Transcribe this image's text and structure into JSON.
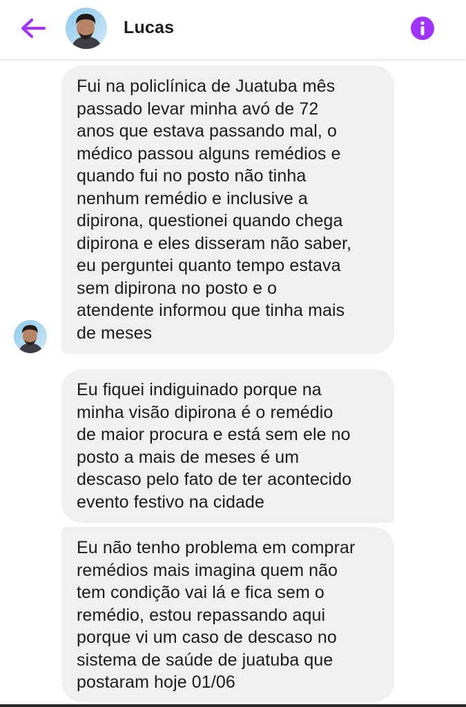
{
  "header": {
    "contact_name": "Lucas",
    "back_icon": "arrow-left-icon",
    "info_icon": "info-icon",
    "accent_color": "#a033ff"
  },
  "conversation": {
    "messages": [
      {
        "text": "Fui na policlínica de Juatuba mês\npassado levar minha avó de 72\nanos que estava passando mal, o\nmédico passou alguns remédios e\nquando fui no posto não tinha\nnenhum remédio e inclusive a\ndipirona, questionei quando chega\ndipirona e eles disseram não saber,\neu perguntei quanto tempo estava\nsem dipirona no posto e o\natendente informou que tinha mais\nde meses"
      },
      {
        "text": "Eu fiquei indiguinado porque na\nminha visão dipirona é o remédio\nde maior procura e está sem ele no\nposto a mais de meses é um\ndescaso pelo fato de ter acontecido\nevento festivo na cidade"
      },
      {
        "text": "Eu não tenho problema em comprar\nremédios mais imagina quem não\ntem condição vai lá e fica sem o\nremédio, estou repassando aqui\nporque vi um caso de descaso no\nsistema de saúde de juatuba que\npostaram hoje 01/06"
      }
    ],
    "bubble_color": "#f0f0f0"
  }
}
